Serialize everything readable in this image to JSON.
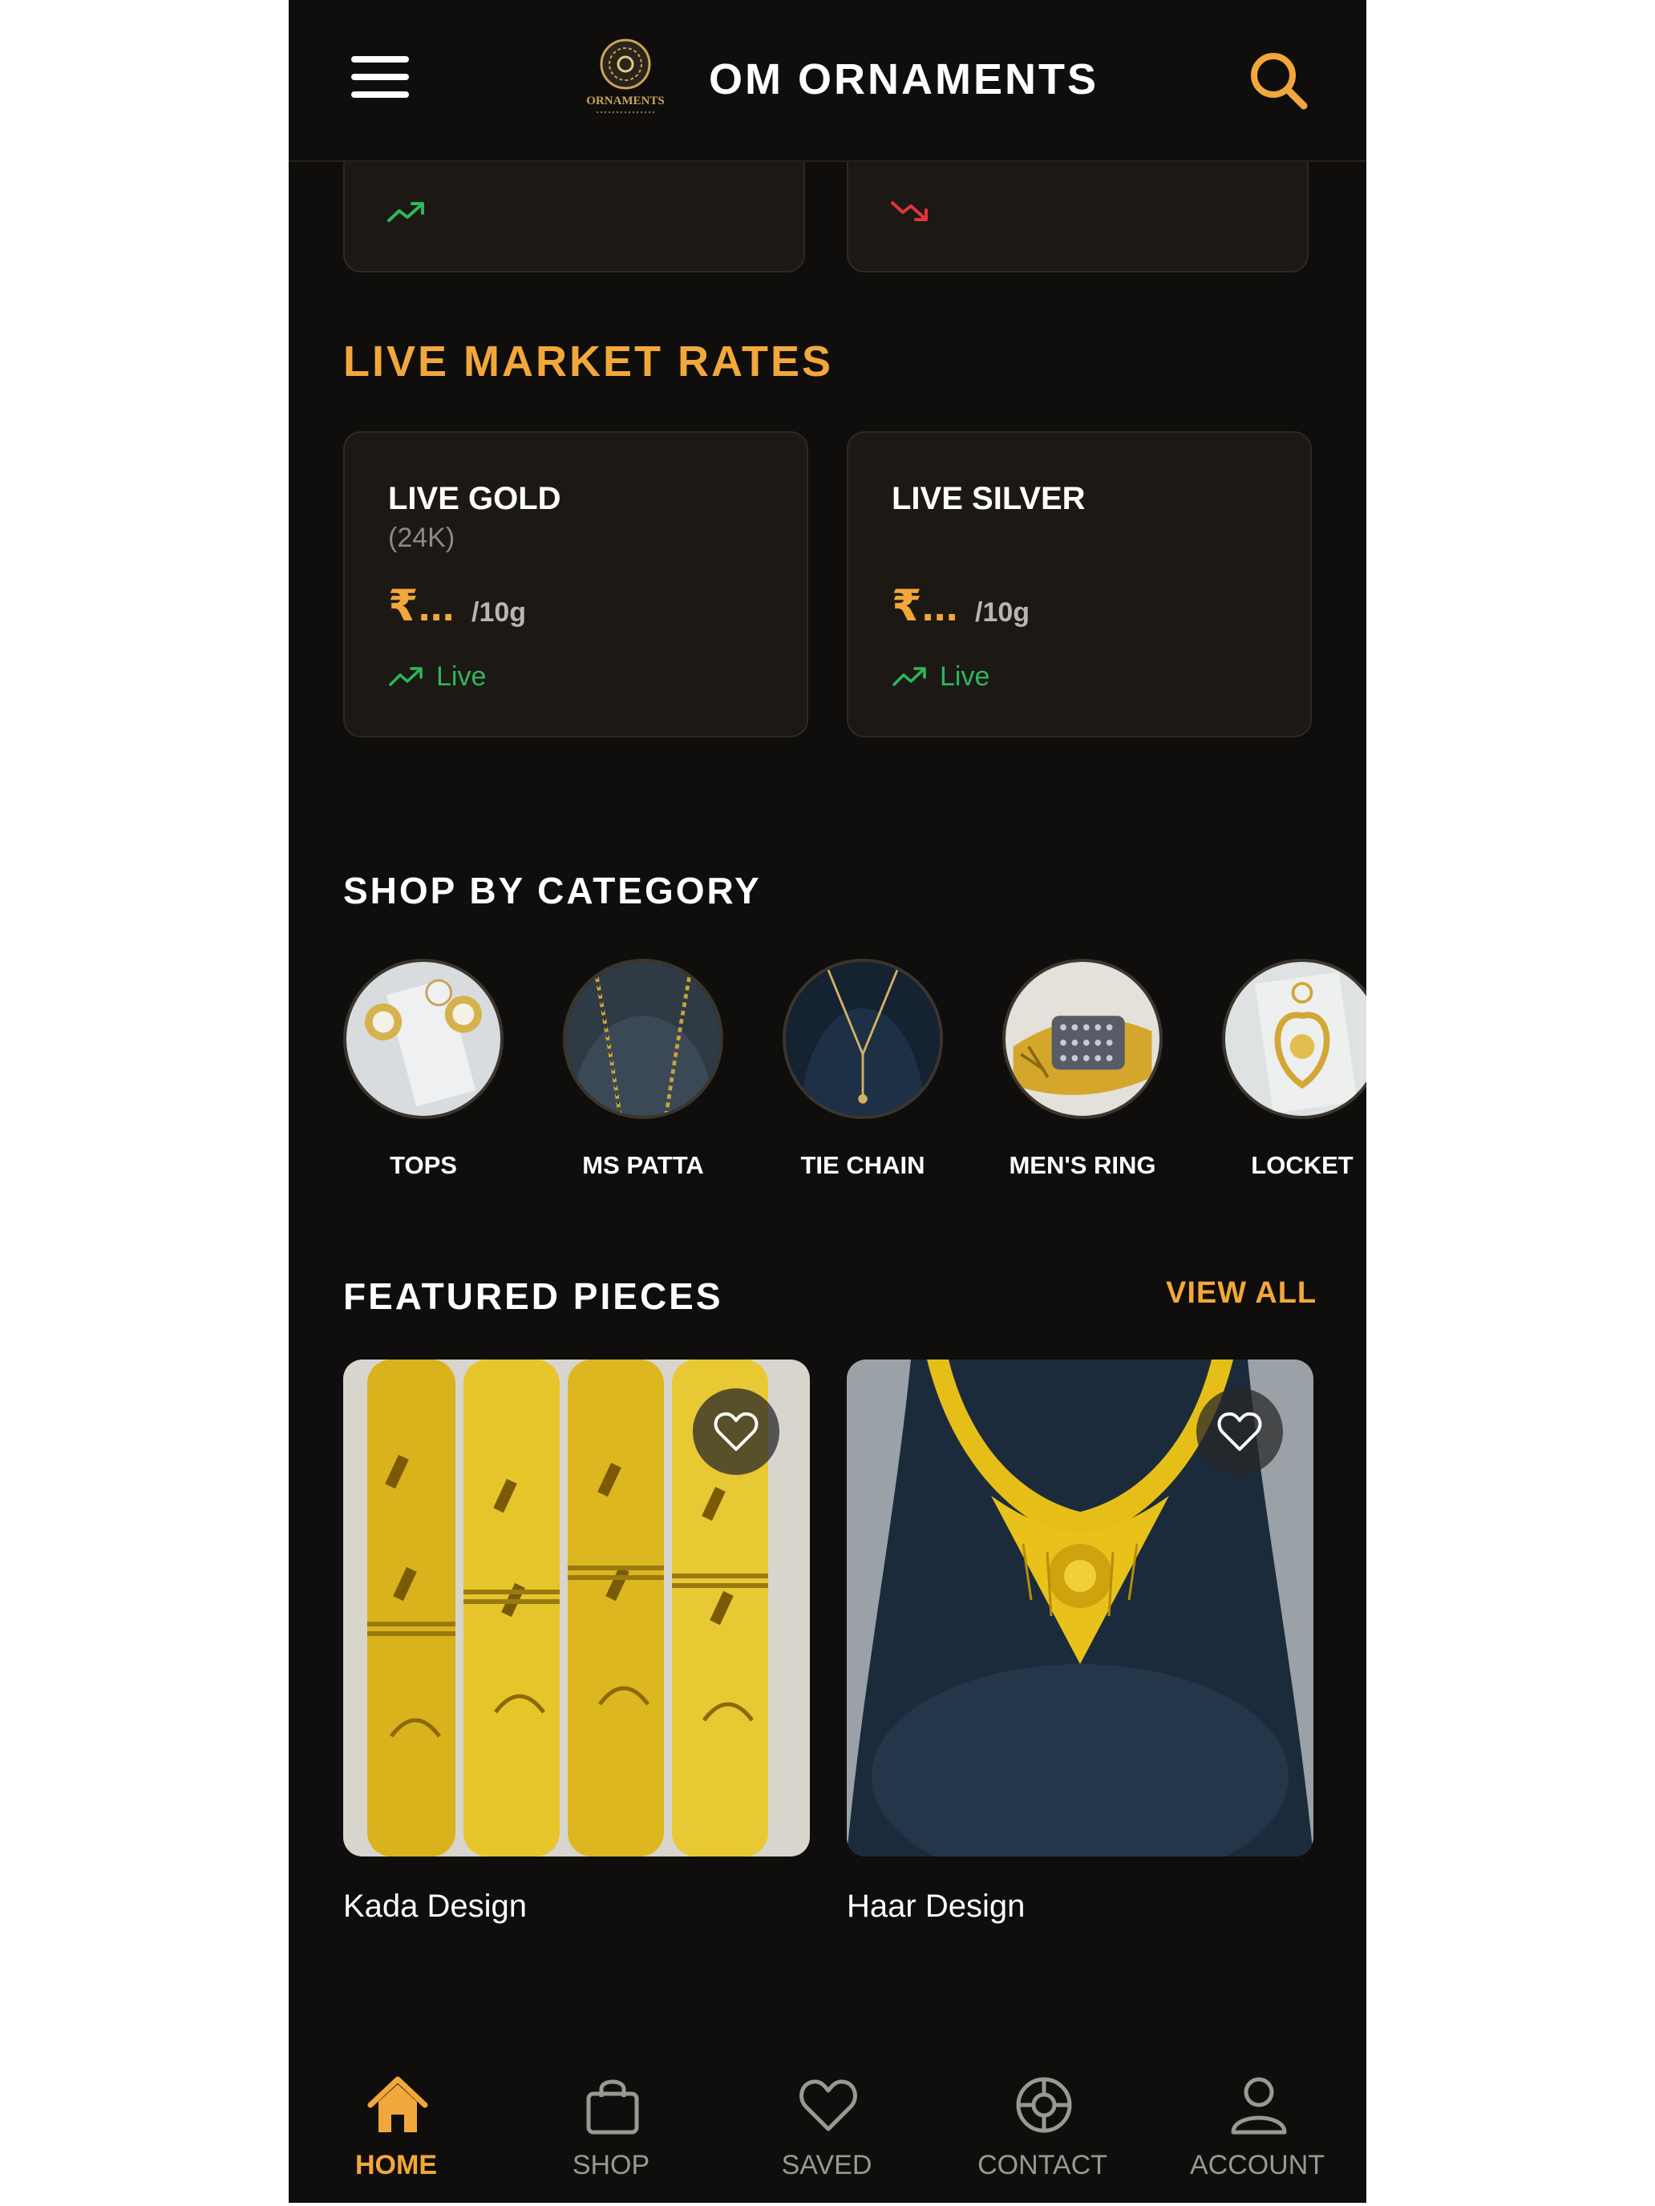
{
  "app": {
    "title": "OM ORNAMENTS",
    "logo_text": "ORNAMENTS",
    "accent_color": "#f2a73b",
    "up_color": "#2fb75b",
    "down_color": "#e0353a"
  },
  "header": {
    "menu_icon": "hamburger-menu-icon",
    "search_icon": "search-icon"
  },
  "top_cards": [
    {
      "trend": "up",
      "icon": "trend-up-icon"
    },
    {
      "trend": "down",
      "icon": "trend-down-icon"
    }
  ],
  "live_market": {
    "title": "LIVE MARKET RATES",
    "cards": [
      {
        "name": "LIVE GOLD",
        "karat": "(24K)",
        "price": "₹...",
        "unit": "/10g",
        "status": "Live"
      },
      {
        "name": "LIVE SILVER",
        "karat": "",
        "price": "₹...",
        "unit": "/10g",
        "status": "Live"
      }
    ]
  },
  "categories": {
    "title": "SHOP BY CATEGORY",
    "items": [
      {
        "label": "TOPS"
      },
      {
        "label": "MS PATTA"
      },
      {
        "label": "TIE CHAIN"
      },
      {
        "label": "MEN'S RING"
      },
      {
        "label": "LOCKET"
      }
    ]
  },
  "featured": {
    "title": "FEATURED PIECES",
    "view_all": "VIEW ALL",
    "items": [
      {
        "name": "Kada Design",
        "favorite": false
      },
      {
        "name": "Haar Design",
        "favorite": false
      }
    ]
  },
  "bottom_nav": {
    "active": "HOME",
    "items": [
      {
        "label": "HOME",
        "icon": "home-icon"
      },
      {
        "label": "SHOP",
        "icon": "shopping-bag-icon"
      },
      {
        "label": "SAVED",
        "icon": "heart-icon"
      },
      {
        "label": "CONTACT",
        "icon": "support-icon"
      },
      {
        "label": "ACCOUNT",
        "icon": "user-icon"
      }
    ]
  }
}
